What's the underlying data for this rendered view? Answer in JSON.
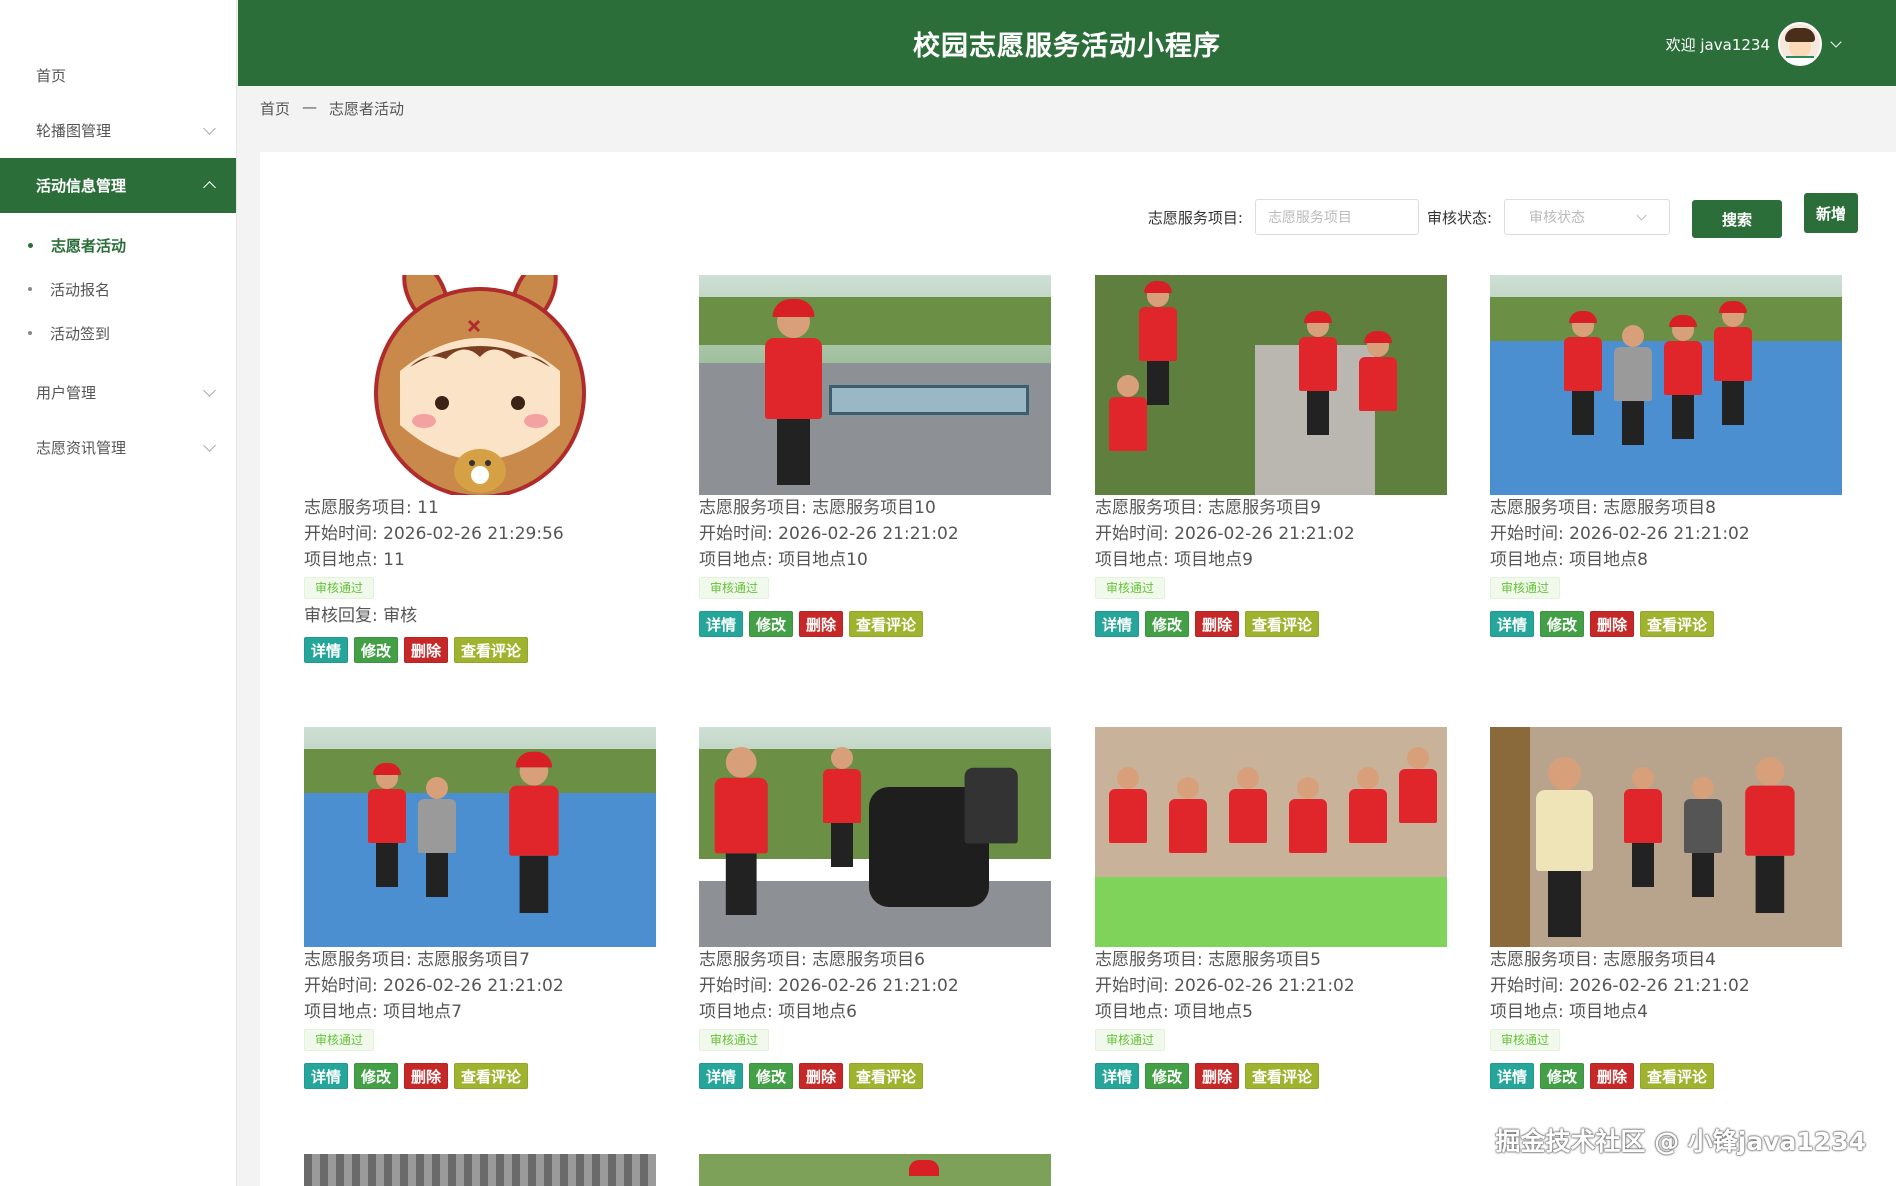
{
  "app": {
    "title": "校园志愿服务活动小程序",
    "welcome": "欢迎 java1234"
  },
  "sidebar": {
    "items": [
      {
        "label": "首页"
      },
      {
        "label": "轮播图管理"
      },
      {
        "label": "活动信息管理"
      },
      {
        "label": "用户管理"
      },
      {
        "label": "志愿资讯管理"
      }
    ],
    "sub_items": [
      {
        "label": "志愿者活动"
      },
      {
        "label": "活动报名"
      },
      {
        "label": "活动签到"
      }
    ]
  },
  "breadcrumb": {
    "home": "首页",
    "separator": "—",
    "current": "志愿者活动"
  },
  "search": {
    "project_label": "志愿服务项目:",
    "project_placeholder": "志愿服务项目",
    "status_label": "审核状态:",
    "status_placeholder": "审核状态",
    "search_button": "搜索",
    "add_button": "新增"
  },
  "actions": {
    "detail": "详情",
    "edit": "修改",
    "delete": "删除",
    "comment": "查看评论"
  },
  "cards": [
    {
      "project": "志愿服务项目: 11",
      "start": "开始时间: 2026-02-26 21:29:56",
      "location": "项目地点: 11",
      "status": "审核通过",
      "reply": "审核回复: 审核"
    },
    {
      "project": "志愿服务项目: 志愿服务项目10",
      "start": "开始时间: 2026-02-26 21:21:02",
      "location": "项目地点: 项目地点10",
      "status": "审核通过"
    },
    {
      "project": "志愿服务项目: 志愿服务项目9",
      "start": "开始时间: 2026-02-26 21:21:02",
      "location": "项目地点: 项目地点9",
      "status": "审核通过"
    },
    {
      "project": "志愿服务项目: 志愿服务项目8",
      "start": "开始时间: 2026-02-26 21:21:02",
      "location": "项目地点: 项目地点8",
      "status": "审核通过"
    },
    {
      "project": "志愿服务项目: 志愿服务项目7",
      "start": "开始时间: 2026-02-26 21:21:02",
      "location": "项目地点: 项目地点7",
      "status": "审核通过"
    },
    {
      "project": "志愿服务项目: 志愿服务项目6",
      "start": "开始时间: 2026-02-26 21:21:02",
      "location": "项目地点: 项目地点6",
      "status": "审核通过"
    },
    {
      "project": "志愿服务项目: 志愿服务项目5",
      "start": "开始时间: 2026-02-26 21:21:02",
      "location": "项目地点: 项目地点5",
      "status": "审核通过"
    },
    {
      "project": "志愿服务项目: 志愿服务项目4",
      "start": "开始时间: 2026-02-26 21:21:02",
      "location": "项目地点: 项目地点4",
      "status": "审核通过"
    }
  ],
  "watermark": "掘金技术社区 @ 小锋java1234",
  "colors": {
    "primary": "#2c6e3a",
    "detail": "#26a69a",
    "edit": "#43a047",
    "delete": "#c62828",
    "comment": "#9fb32e"
  }
}
